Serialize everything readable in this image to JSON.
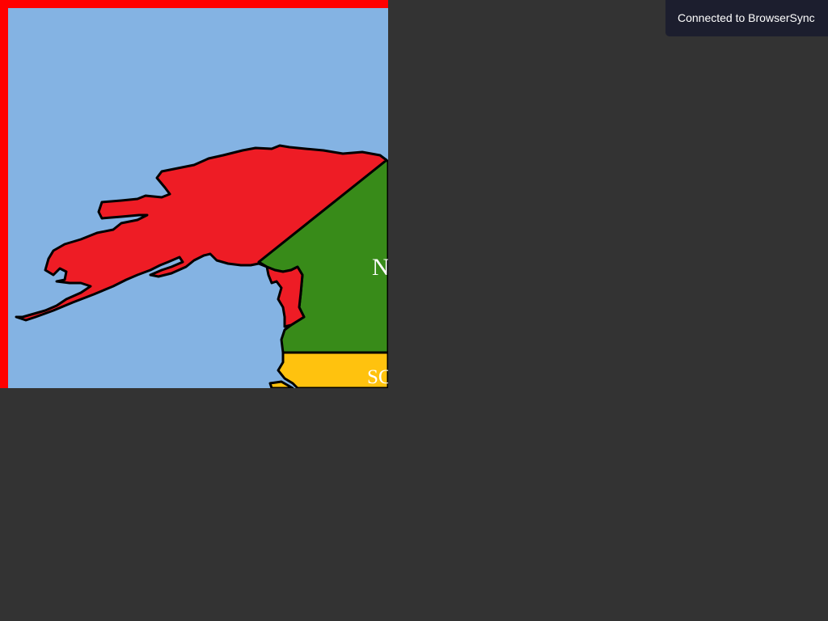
{
  "map": {
    "colors": {
      "frame": "#ff0000",
      "ocean": "#84b3e3",
      "alaska": "#ee1c25",
      "north_region": "#388b19",
      "south_region": "#ffc20e",
      "border": "#000000",
      "label": "#ffffff"
    },
    "regions": [
      {
        "id": "alaska",
        "label": ""
      },
      {
        "id": "north",
        "label": "N"
      },
      {
        "id": "south",
        "label": "SC"
      }
    ]
  },
  "notification": {
    "text": "Connected to BrowserSync"
  }
}
